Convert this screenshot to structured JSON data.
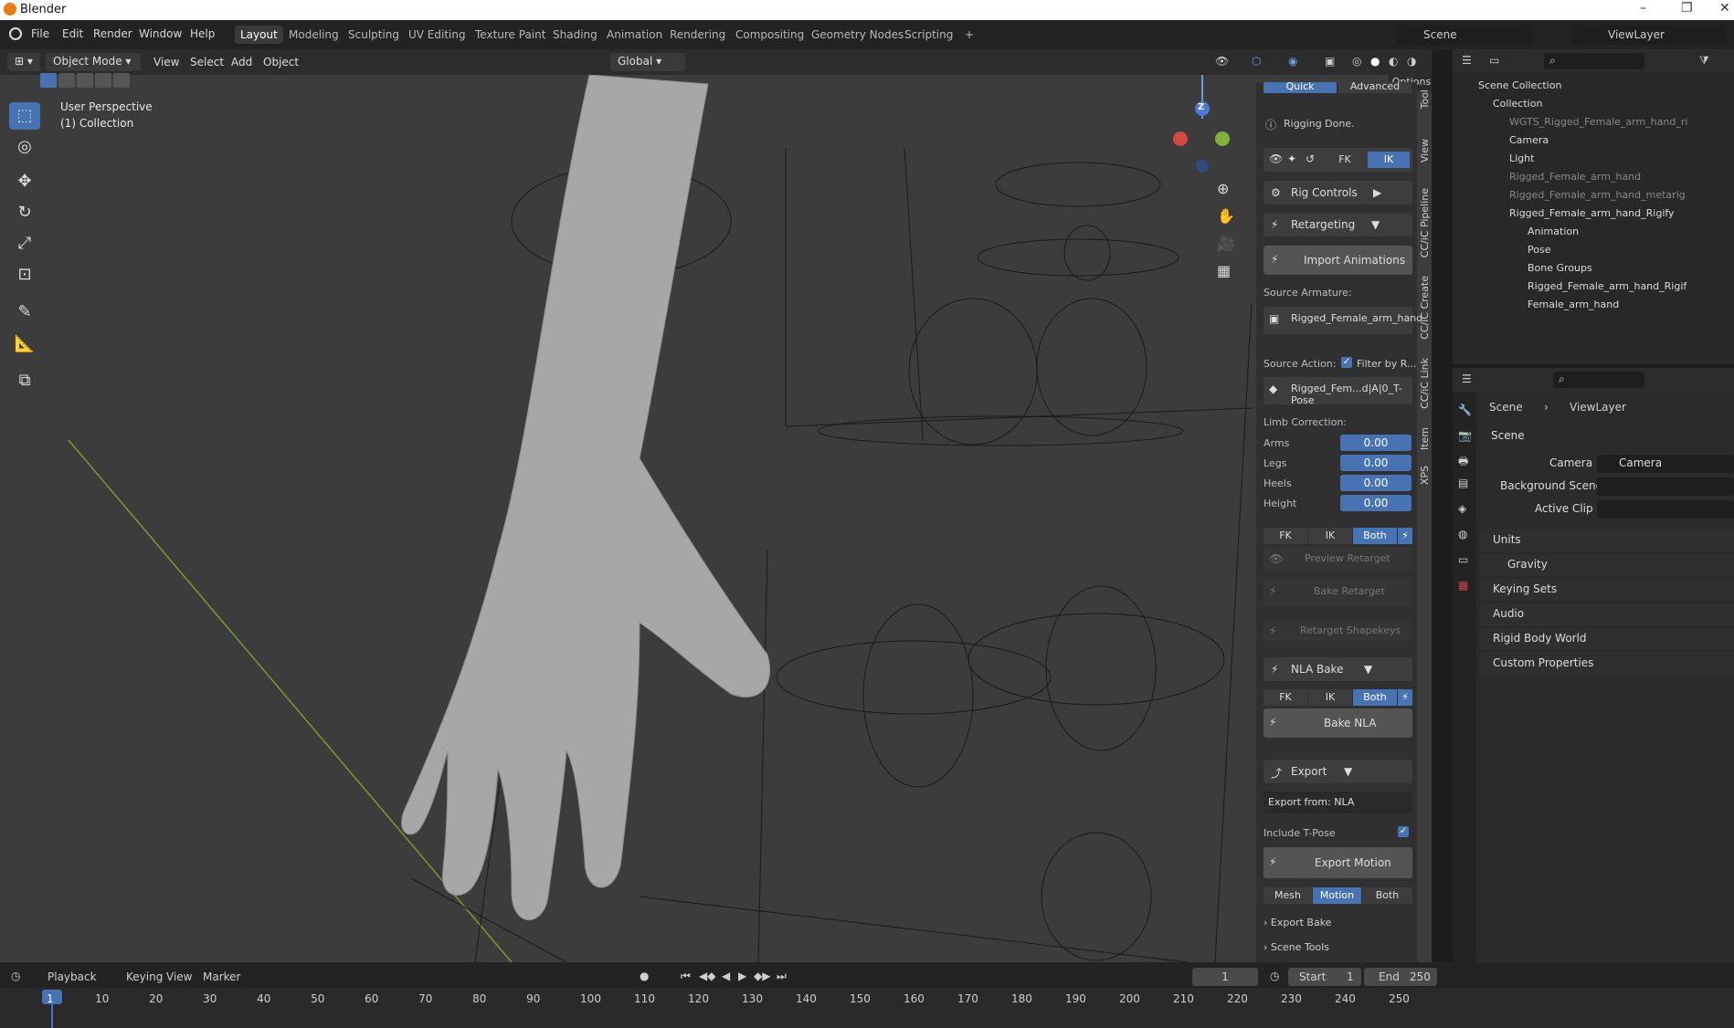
{
  "app": {
    "title": "Blender"
  },
  "menu": [
    "File",
    "Edit",
    "Render",
    "Window",
    "Help"
  ],
  "workspaces": [
    "Layout",
    "Modeling",
    "Sculpting",
    "UV Editing",
    "Texture Paint",
    "Shading",
    "Animation",
    "Rendering",
    "Compositing",
    "Geometry Nodes",
    "Scripting",
    "+"
  ],
  "scene_field": "Scene",
  "viewlayer_field": "ViewLayer",
  "header3d": {
    "mode": "Object Mode",
    "menus": [
      "View",
      "Select",
      "Add",
      "Object"
    ],
    "orientation": "Global",
    "options": "Options"
  },
  "viewport": {
    "line1": "User Perspective",
    "line2": "(1) Collection"
  },
  "npanel": {
    "tabs_top": [
      "Quick",
      "Advanced"
    ],
    "status": "Rigging Done.",
    "fk": "FK",
    "ik": "IK",
    "rig_controls": "Rig Controls",
    "retargeting": "Retargeting",
    "import_animations": "Import Animations",
    "source_armature_label": "Source Armature:",
    "source_armature_value": "Rigged_Female_arm_hand",
    "source_action_label": "Source Action:",
    "filter_label": "Filter by R...",
    "source_action_value": "Rigged_Fem...d|A|0_T-Pose",
    "limb_correction": "Limb Correction:",
    "limbs": [
      {
        "label": "Arms",
        "value": "0.00"
      },
      {
        "label": "Legs",
        "value": "0.00"
      },
      {
        "label": "Heels",
        "value": "0.00"
      },
      {
        "label": "Height",
        "value": "0.00"
      }
    ],
    "seg1": [
      "FK",
      "IK",
      "Both"
    ],
    "preview_retarget": "Preview Retarget",
    "bake_retarget": "Bake Retarget",
    "retarget_shapekeys": "Retarget Shapekeys",
    "nla_bake": "NLA Bake",
    "seg2": [
      "FK",
      "IK",
      "Both"
    ],
    "bake_nla": "Bake NLA",
    "export": "Export",
    "export_from": "Export from: NLA",
    "include_tpose": "Include T-Pose",
    "export_motion": "Export Motion",
    "seg3": [
      "Mesh",
      "Motion",
      "Both"
    ],
    "export_bake": "Export Bake",
    "scene_tools": "Scene Tools"
  },
  "vtabs": [
    "Tool",
    "View",
    "CC/iC Pipeline",
    "CC/iC Create",
    "CC/iC Link",
    "Item",
    "XPS"
  ],
  "outliner": {
    "rows": [
      {
        "label": "Scene Collection",
        "indent": 0
      },
      {
        "label": "Collection",
        "indent": 1
      },
      {
        "label": "WGTS_Rigged_Female_arm_hand_ri",
        "indent": 2
      },
      {
        "label": "Camera",
        "indent": 2
      },
      {
        "label": "Light",
        "indent": 2
      },
      {
        "label": "Rigged_Female_arm_hand",
        "indent": 2
      },
      {
        "label": "Rigged_Female_arm_hand_metarig",
        "indent": 2
      },
      {
        "label": "Rigged_Female_arm_hand_Rigify",
        "indent": 2
      },
      {
        "label": "Animation",
        "indent": 3
      },
      {
        "label": "Pose",
        "indent": 3
      },
      {
        "label": "Bone Groups",
        "indent": 3
      },
      {
        "label": "Rigged_Female_arm_hand_Rigif",
        "indent": 3
      },
      {
        "label": "Female_arm_hand",
        "indent": 3
      }
    ]
  },
  "props": {
    "breadcrumb1": "Scene",
    "breadcrumb2": "ViewLayer",
    "section": "Scene",
    "camera_label": "Camera",
    "camera_value": "Camera",
    "bg_scene_label": "Background Scene",
    "active_clip_label": "Active Clip",
    "subsections": [
      "Units",
      "Gravity",
      "Keying Sets",
      "Audio",
      "Rigid Body World",
      "Custom Properties"
    ]
  },
  "timeline": {
    "menus": [
      "Playback",
      "Keying",
      "View",
      "Marker"
    ],
    "current": "1",
    "start_label": "Start",
    "start": "1",
    "end_label": "End",
    "end": "250",
    "ticks": [
      "1",
      "10",
      "20",
      "30",
      "40",
      "50",
      "60",
      "70",
      "80",
      "90",
      "100",
      "110",
      "120",
      "130",
      "140",
      "150",
      "160",
      "170",
      "180",
      "190",
      "200",
      "210",
      "220",
      "230",
      "240",
      "250"
    ]
  }
}
